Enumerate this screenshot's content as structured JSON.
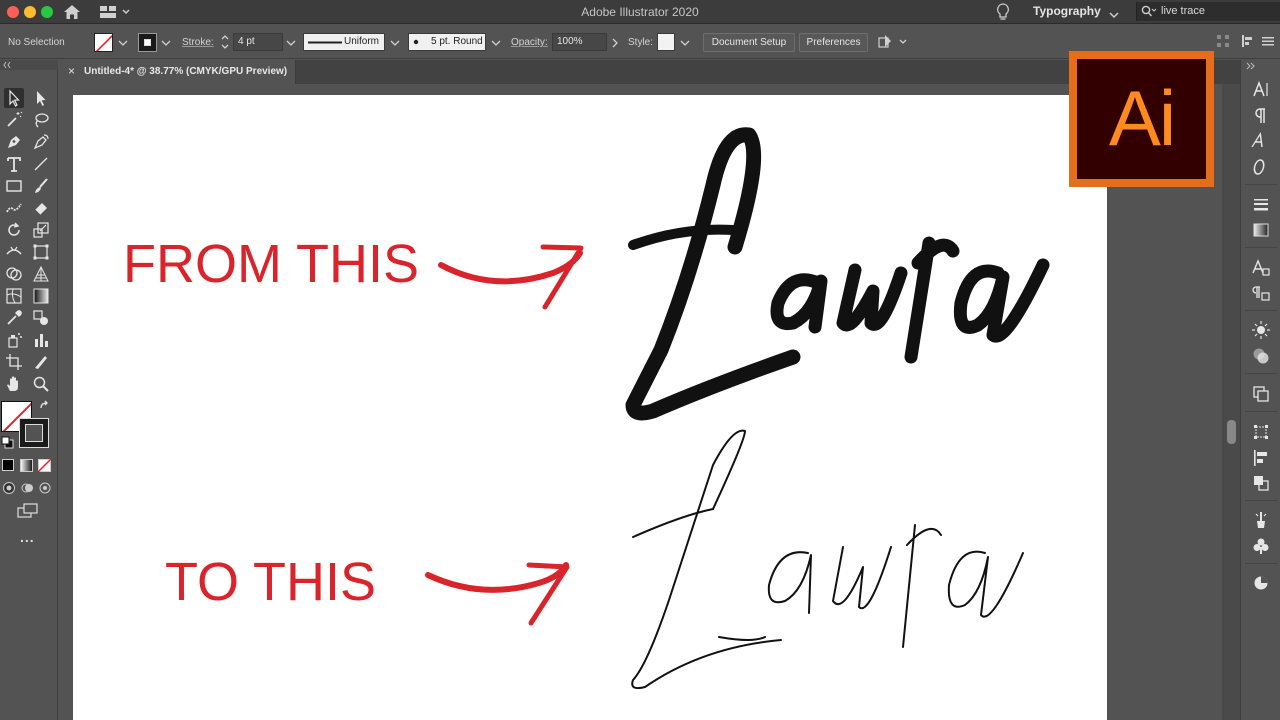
{
  "window": {
    "title": "Adobe Illustrator 2020"
  },
  "header": {
    "workspace": "Typography",
    "search_value": "live trace"
  },
  "control_bar": {
    "selection": "No Selection",
    "stroke_label": "Stroke:",
    "stroke_weight": "4 pt",
    "profile": "Uniform",
    "brush": "5 pt. Round",
    "opacity_label": "Opacity:",
    "opacity": "100%",
    "style_label": "Style:",
    "document_setup": "Document Setup",
    "preferences": "Preferences"
  },
  "document": {
    "tab_title": "Untitled-4* @ 38.77% (CMYK/GPU Preview)",
    "close_glyph": "×"
  },
  "artwork": {
    "from_text": "FROM THIS",
    "to_text": "TO THIS",
    "filled_word": "Laura",
    "outline_word": "Laura",
    "accent_color": "#d9242b"
  },
  "logo": {
    "text": "Ai",
    "frame_color": "#e46e1c",
    "bg_color": "#330000"
  },
  "toolbar": {
    "more_label": "..."
  }
}
